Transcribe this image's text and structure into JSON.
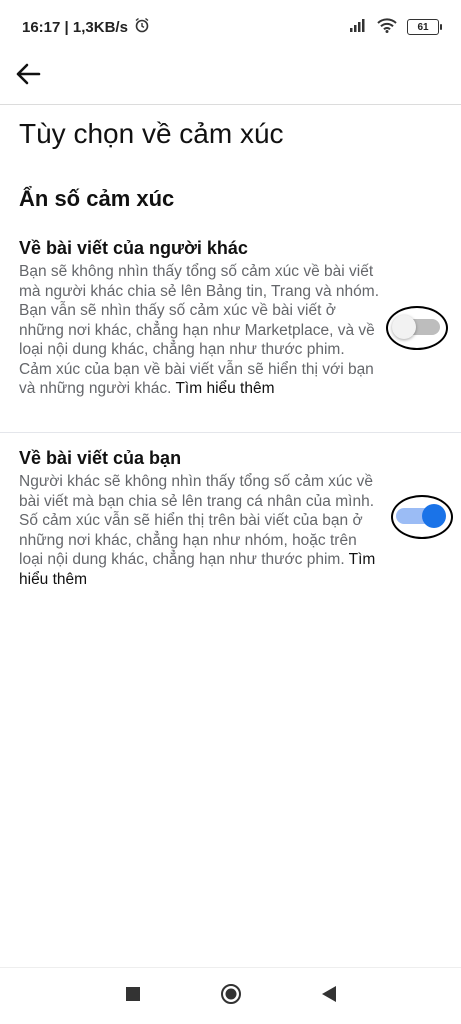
{
  "status_bar": {
    "time_speed": "16:17 | 1,3KB/s",
    "battery": "61"
  },
  "page": {
    "title": "Tùy chọn về cảm xúc",
    "section_title": "Ẩn số cảm xúc"
  },
  "settings": [
    {
      "title": "Về bài viết của người khác",
      "description": "Bạn sẽ không nhìn thấy tổng số cảm xúc về bài viết mà người khác chia sẻ lên Bảng tin, Trang và nhóm. Bạn vẫn sẽ nhìn thấy số cảm xúc về bài viết ở những nơi khác, chẳng hạn như Marketplace, và về loại nội dung khác, chẳng hạn như thước phim. Cảm xúc của bạn về bài viết vẫn sẽ hiển thị với bạn và những người khác.",
      "learn_more": "Tìm hiểu thêm",
      "enabled": false
    },
    {
      "title": "Về bài viết của bạn",
      "description": "Người khác sẽ không nhìn thấy tổng số cảm xúc về bài viết mà bạn chia sẻ lên trang cá nhân của mình. Số cảm xúc vẫn sẽ hiển thị trên bài viết của bạn ở những nơi khác, chẳng hạn như nhóm, hoặc trên loại nội dung khác, chẳng hạn như thước phim.",
      "learn_more": "Tìm hiểu thêm",
      "enabled": true
    }
  ],
  "colors": {
    "toggle_on": "#1a73e8",
    "toggle_off_track": "#bdbdbd"
  }
}
